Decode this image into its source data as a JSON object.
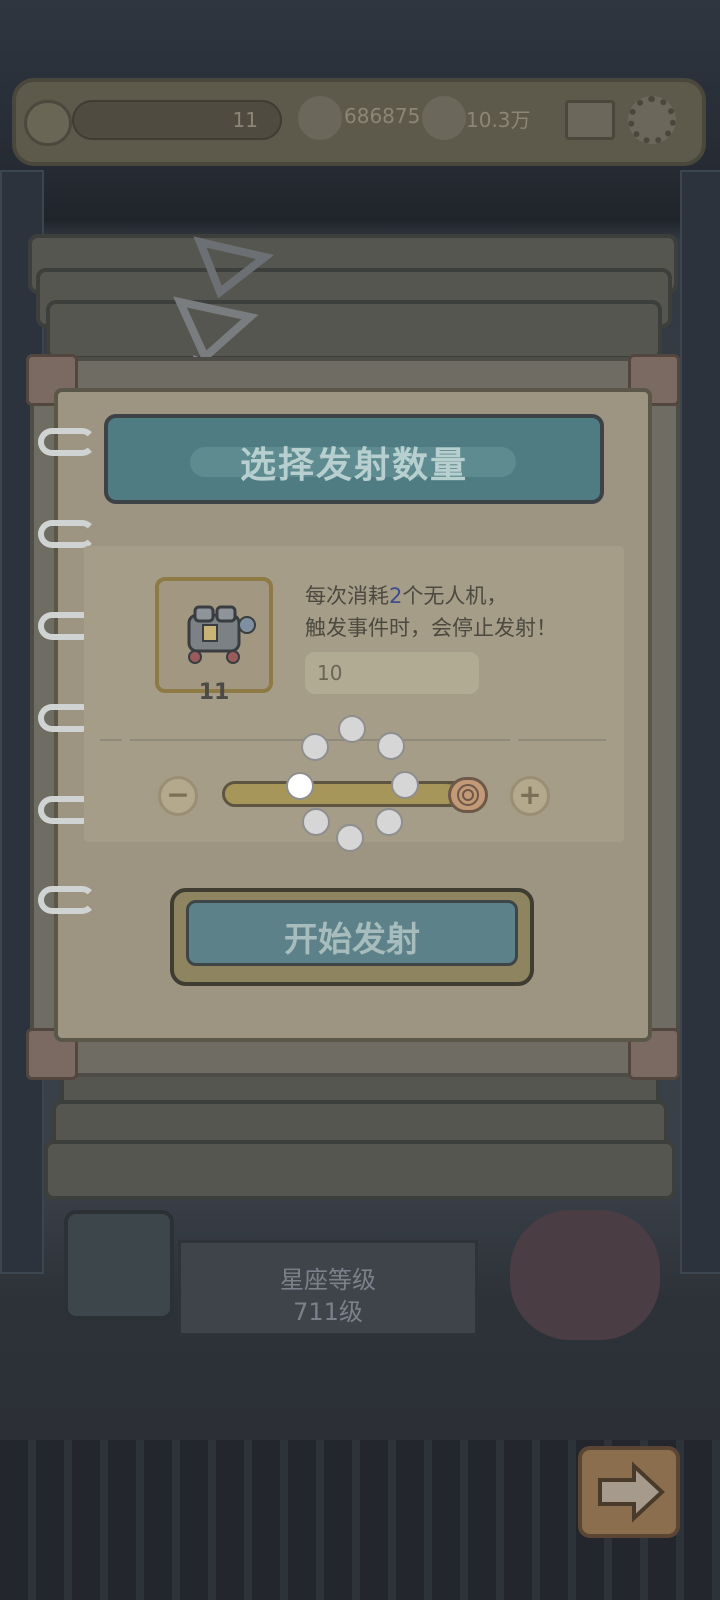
{
  "hud": {
    "level": "11",
    "currency_1": "686875",
    "currency_2": "10.3万",
    "mail_icon": "envelope-icon",
    "settings_icon": "gear-icon"
  },
  "dialog": {
    "title": "选择发射数量",
    "item_count": "11",
    "desc_line1_prefix": "每次消耗",
    "desc_line1_highlight": "2",
    "desc_line1_suffix": "个无人机，",
    "desc_line2": "触发事件时，会停止发射！",
    "quantity_value": "10",
    "minus_label": "−",
    "plus_label": "+",
    "slider_fraction": 0.95,
    "start_button": "开始发射"
  },
  "background": {
    "constellation_label": "星座等级",
    "constellation_level": "711级"
  },
  "colors": {
    "highlight": "#3d4e8a",
    "overlay": "#000000"
  }
}
